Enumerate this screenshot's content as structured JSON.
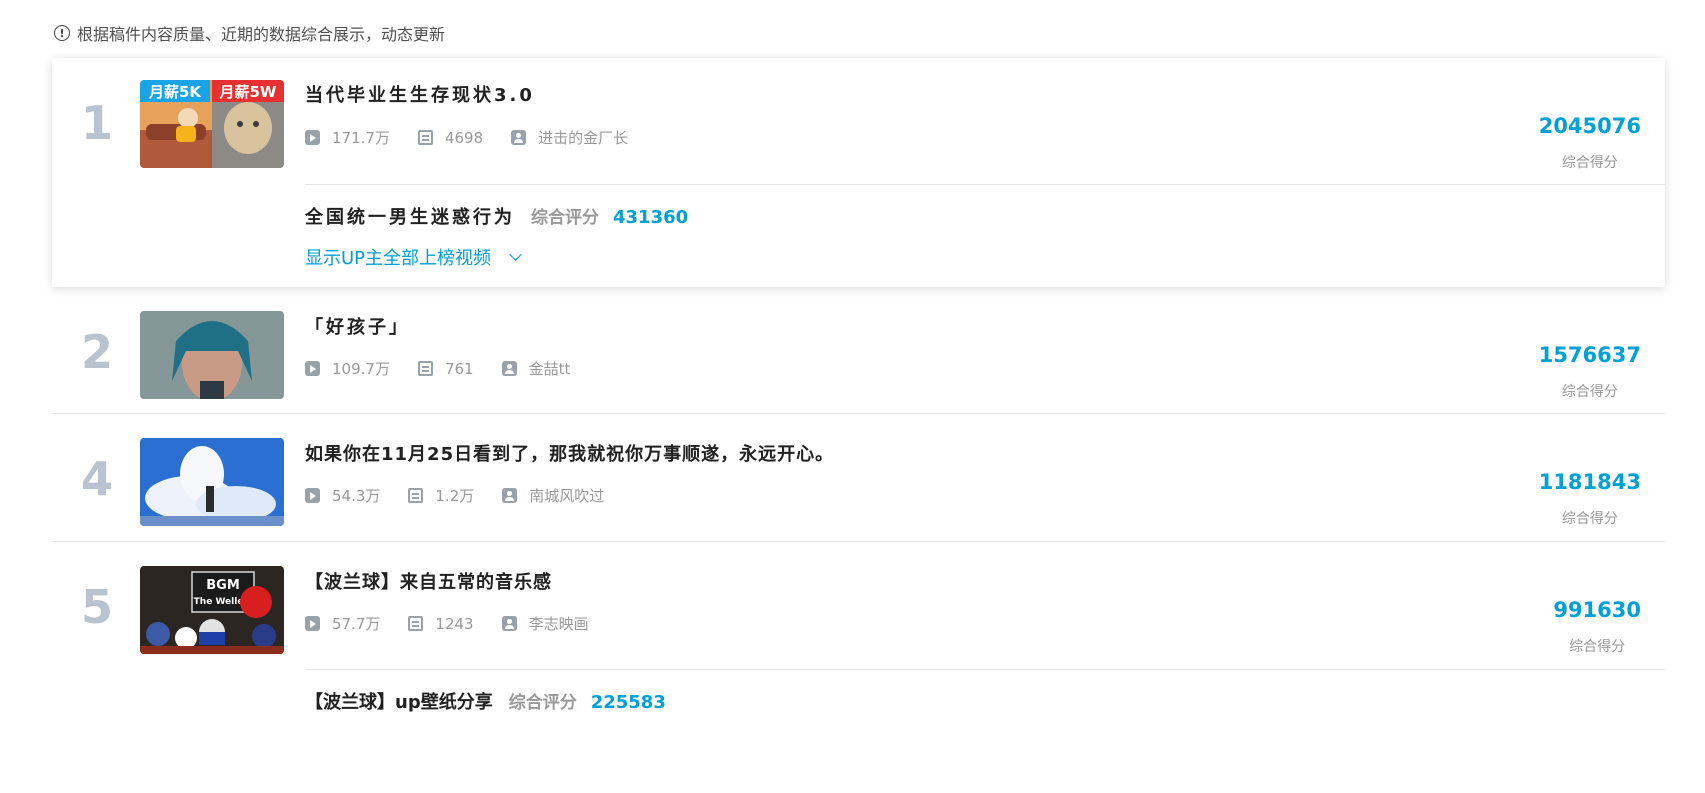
{
  "notice": {
    "icon": "info-circle-icon",
    "text": "根据稿件内容质量、近期的数据综合展示，动态更新"
  },
  "items": [
    {
      "rank": "1",
      "title": "当代毕业生生存现状3.0",
      "thumb_badges": [
        "月薪5K",
        "月薪5W"
      ],
      "plays": "171.7万",
      "danmaku": "4698",
      "author": "进击的金厂长",
      "score": "2045076",
      "score_label": "综合得分",
      "others": [
        {
          "title": "全国统一男生迷惑行为",
          "label": "综合评分",
          "score": "431360"
        }
      ],
      "show_more": "显示UP主全部上榜视频"
    },
    {
      "rank": "2",
      "title": "「好孩子」",
      "plays": "109.7万",
      "danmaku": "761",
      "author": "金喆tt",
      "score": "1576637",
      "score_label": "综合得分"
    },
    {
      "rank": "4",
      "title": "如果你在11月25日看到了，那我就祝你万事顺遂，永远开心。",
      "plays": "54.3万",
      "danmaku": "1.2万",
      "author": "南城风吹过",
      "score": "1181843",
      "score_label": "综合得分"
    },
    {
      "rank": "5",
      "title": "【波兰球】来自五常的音乐感",
      "thumb_badges": [
        "BGM",
        "The Wellerr"
      ],
      "plays": "57.7万",
      "danmaku": "1243",
      "author": "李志映画",
      "score": "991630",
      "score_label": "综合得分",
      "others": [
        {
          "title": "【波兰球】up壁纸分享",
          "label": "综合评分",
          "score": "225583"
        }
      ]
    }
  ],
  "colors": {
    "accent": "#00a1d6",
    "rank_number": "#b9c2cf",
    "meta_text": "#999999"
  }
}
